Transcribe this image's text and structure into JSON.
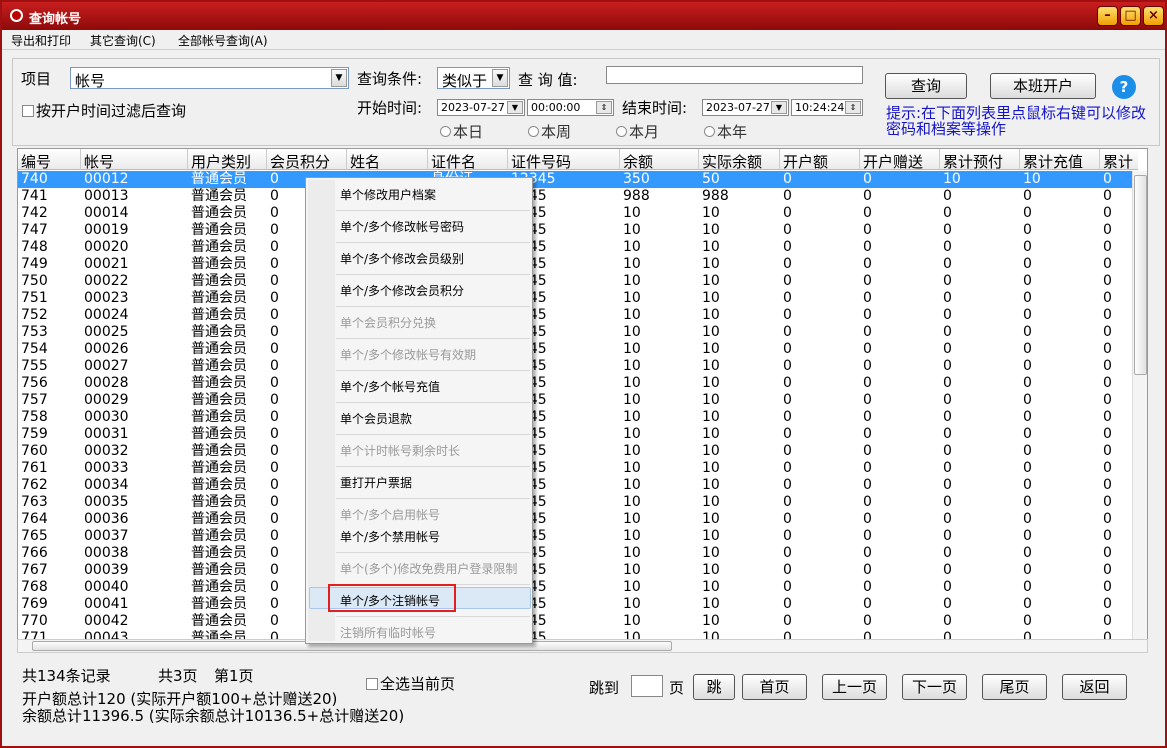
{
  "window": {
    "title": "查询帐号"
  },
  "menu": [
    "导出和打印",
    "其它查询(C)",
    "全部帐号查询(A)"
  ],
  "search": {
    "item_label": "项目",
    "item_value": "帐号",
    "cond_label": "查询条件:",
    "cond_value": "类似于",
    "value_label": "查 询 值:",
    "value_input": "",
    "filter_label": "按开户时间过滤后查询",
    "start_label": "开始时间:",
    "start_date": "2023-07-27",
    "start_time": "00:00:00",
    "end_label": "结束时间:",
    "end_date": "2023-07-27",
    "end_time": "10:24:24",
    "radios": [
      "本日",
      "本周",
      "本月",
      "本年"
    ],
    "query_btn": "查询",
    "open_btn": "本班开户",
    "help_btn": "?",
    "hint": "提示:在下面列表里点鼠标右键可以修改密码和档案等操作"
  },
  "table": {
    "columns": [
      "编号",
      "帐号",
      "用户类别",
      "会员积分",
      "姓名",
      "证件名",
      "证件号码",
      "余额",
      "实际余额",
      "开户额",
      "开户赠送",
      "累计预付",
      "累计充值",
      "累计"
    ],
    "rows": [
      [
        "740",
        "00012",
        "普通会员",
        "0",
        "",
        "身份证",
        "12345",
        "350",
        "50",
        "0",
        "0",
        "10",
        "10",
        "0"
      ],
      [
        "741",
        "00013",
        "普通会员",
        "0",
        "",
        "",
        "2345",
        "988",
        "988",
        "0",
        "0",
        "0",
        "0",
        "0"
      ],
      [
        "742",
        "00014",
        "普通会员",
        "0",
        "",
        "",
        "2345",
        "10",
        "10",
        "0",
        "0",
        "0",
        "0",
        "0"
      ],
      [
        "747",
        "00019",
        "普通会员",
        "0",
        "",
        "",
        "2345",
        "10",
        "10",
        "0",
        "0",
        "0",
        "0",
        "0"
      ],
      [
        "748",
        "00020",
        "普通会员",
        "0",
        "",
        "",
        "2345",
        "10",
        "10",
        "0",
        "0",
        "0",
        "0",
        "0"
      ],
      [
        "749",
        "00021",
        "普通会员",
        "0",
        "",
        "",
        "2345",
        "10",
        "10",
        "0",
        "0",
        "0",
        "0",
        "0"
      ],
      [
        "750",
        "00022",
        "普通会员",
        "0",
        "",
        "",
        "2345",
        "10",
        "10",
        "0",
        "0",
        "0",
        "0",
        "0"
      ],
      [
        "751",
        "00023",
        "普通会员",
        "0",
        "",
        "",
        "2345",
        "10",
        "10",
        "0",
        "0",
        "0",
        "0",
        "0"
      ],
      [
        "752",
        "00024",
        "普通会员",
        "0",
        "",
        "",
        "2345",
        "10",
        "10",
        "0",
        "0",
        "0",
        "0",
        "0"
      ],
      [
        "753",
        "00025",
        "普通会员",
        "0",
        "",
        "",
        "2345",
        "10",
        "10",
        "0",
        "0",
        "0",
        "0",
        "0"
      ],
      [
        "754",
        "00026",
        "普通会员",
        "0",
        "",
        "",
        "2345",
        "10",
        "10",
        "0",
        "0",
        "0",
        "0",
        "0"
      ],
      [
        "755",
        "00027",
        "普通会员",
        "0",
        "",
        "",
        "2345",
        "10",
        "10",
        "0",
        "0",
        "0",
        "0",
        "0"
      ],
      [
        "756",
        "00028",
        "普通会员",
        "0",
        "",
        "",
        "2345",
        "10",
        "10",
        "0",
        "0",
        "0",
        "0",
        "0"
      ],
      [
        "757",
        "00029",
        "普通会员",
        "0",
        "",
        "",
        "2345",
        "10",
        "10",
        "0",
        "0",
        "0",
        "0",
        "0"
      ],
      [
        "758",
        "00030",
        "普通会员",
        "0",
        "",
        "",
        "2345",
        "10",
        "10",
        "0",
        "0",
        "0",
        "0",
        "0"
      ],
      [
        "759",
        "00031",
        "普通会员",
        "0",
        "",
        "",
        "2345",
        "10",
        "10",
        "0",
        "0",
        "0",
        "0",
        "0"
      ],
      [
        "760",
        "00032",
        "普通会员",
        "0",
        "",
        "",
        "2345",
        "10",
        "10",
        "0",
        "0",
        "0",
        "0",
        "0"
      ],
      [
        "761",
        "00033",
        "普通会员",
        "0",
        "",
        "",
        "2345",
        "10",
        "10",
        "0",
        "0",
        "0",
        "0",
        "0"
      ],
      [
        "762",
        "00034",
        "普通会员",
        "0",
        "",
        "",
        "2345",
        "10",
        "10",
        "0",
        "0",
        "0",
        "0",
        "0"
      ],
      [
        "763",
        "00035",
        "普通会员",
        "0",
        "",
        "",
        "2345",
        "10",
        "10",
        "0",
        "0",
        "0",
        "0",
        "0"
      ],
      [
        "764",
        "00036",
        "普通会员",
        "0",
        "",
        "",
        "2345",
        "10",
        "10",
        "0",
        "0",
        "0",
        "0",
        "0"
      ],
      [
        "765",
        "00037",
        "普通会员",
        "0",
        "",
        "",
        "2345",
        "10",
        "10",
        "0",
        "0",
        "0",
        "0",
        "0"
      ],
      [
        "766",
        "00038",
        "普通会员",
        "0",
        "",
        "",
        "2345",
        "10",
        "10",
        "0",
        "0",
        "0",
        "0",
        "0"
      ],
      [
        "767",
        "00039",
        "普通会员",
        "0",
        "",
        "",
        "2345",
        "10",
        "10",
        "0",
        "0",
        "0",
        "0",
        "0"
      ],
      [
        "768",
        "00040",
        "普通会员",
        "0",
        "",
        "",
        "2345",
        "10",
        "10",
        "0",
        "0",
        "0",
        "0",
        "0"
      ],
      [
        "769",
        "00041",
        "普通会员",
        "0",
        "",
        "",
        "2345",
        "10",
        "10",
        "0",
        "0",
        "0",
        "0",
        "0"
      ],
      [
        "770",
        "00042",
        "普通会员",
        "0",
        "",
        "",
        "2345",
        "10",
        "10",
        "0",
        "0",
        "0",
        "0",
        "0"
      ],
      [
        "771",
        "00043",
        "普通会员",
        "0",
        "",
        "",
        "2345",
        "10",
        "10",
        "0",
        "0",
        "0",
        "0",
        "0"
      ]
    ]
  },
  "context_menu": [
    {
      "label": "单个修改用户档案",
      "enabled": true
    },
    {
      "label": "单个/多个修改帐号密码",
      "enabled": true
    },
    {
      "label": "单个/多个修改会员级别",
      "enabled": true
    },
    {
      "label": "单个/多个修改会员积分",
      "enabled": true
    },
    {
      "label": "单个会员积分兑换",
      "enabled": false
    },
    {
      "label": "单个/多个修改帐号有效期",
      "enabled": false
    },
    {
      "label": "单个/多个帐号充值",
      "enabled": true
    },
    {
      "label": "单个会员退款",
      "enabled": true
    },
    {
      "label": "单个计时帐号剩余时长",
      "enabled": false
    },
    {
      "label": "重打开户票据",
      "enabled": true
    },
    {
      "label": "单个/多个启用帐号",
      "enabled": false
    },
    {
      "label": "单个/多个禁用帐号",
      "enabled": true
    },
    {
      "label": "单个(多个)修改免费用户登录限制",
      "enabled": false
    },
    {
      "label": "单个/多个注销帐号",
      "enabled": true
    },
    {
      "label": "注销所有临时帐号",
      "enabled": false
    }
  ],
  "footer": {
    "records": "共134条记录",
    "pages": "共3页",
    "current_page": "第1页",
    "select_all": "全选当前页",
    "summary1": "开户额总计120 (实际开户额100+总计赠送20)",
    "summary2": "余额总计11396.5 (实际余额总计10136.5+总计赠送20)",
    "jump_label": "跳到",
    "page_unit": "页",
    "jump_btn": "跳",
    "first": "首页",
    "prev": "上一页",
    "next": "下一页",
    "last": "尾页",
    "back": "返回"
  }
}
